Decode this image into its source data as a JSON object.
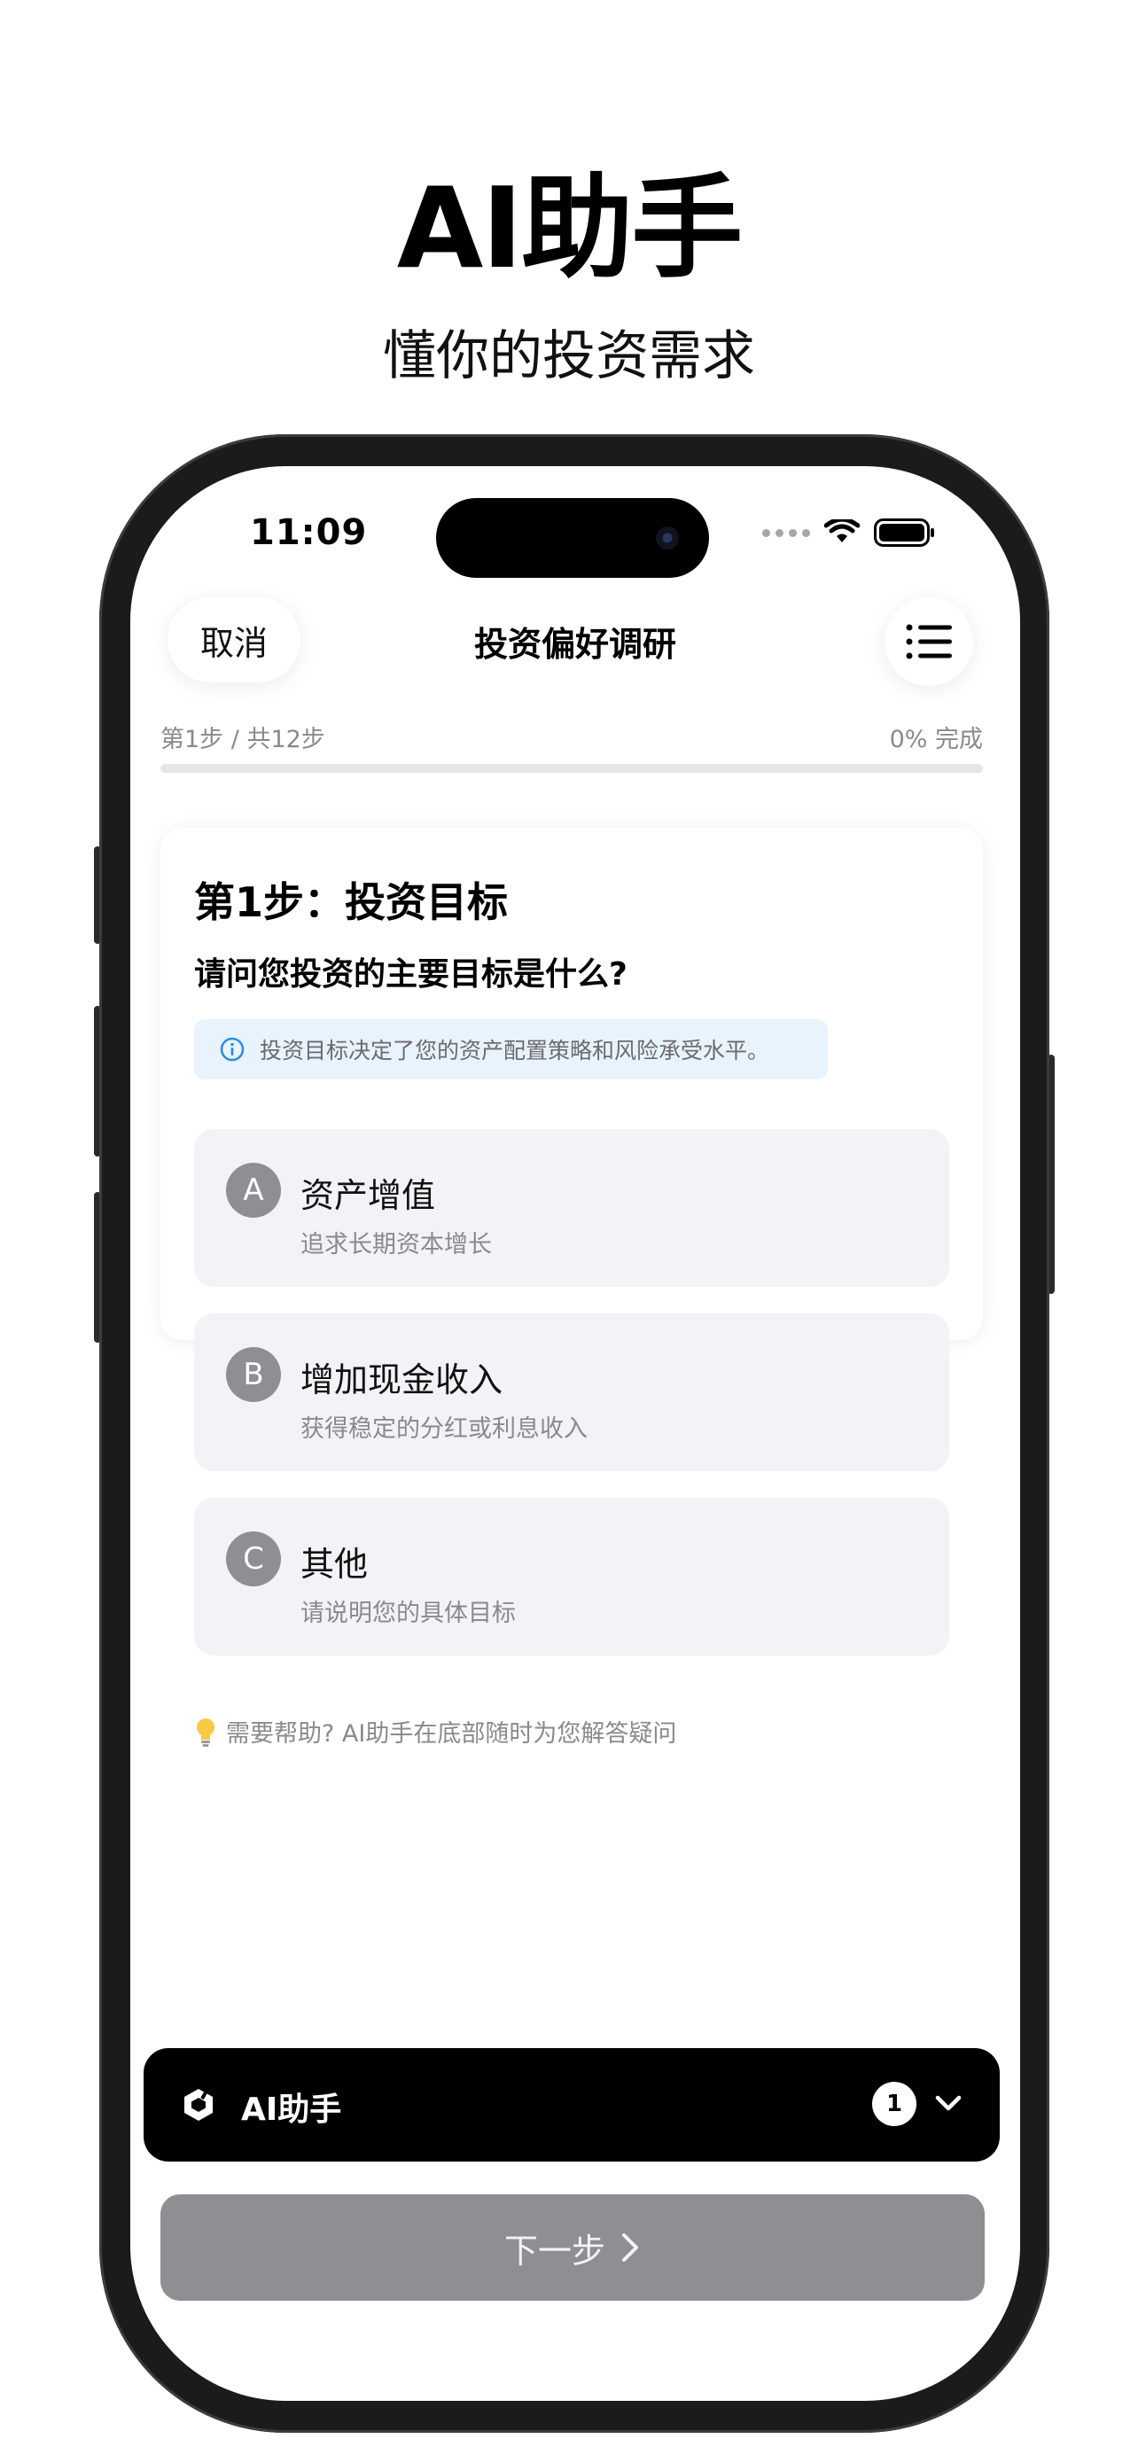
{
  "hero": {
    "title": "AI助手",
    "subtitle": "懂你的投资需求"
  },
  "status_bar": {
    "time": "11:09"
  },
  "nav": {
    "cancel_label": "取消",
    "title": "投资偏好调研",
    "menu_icon": "list-icon"
  },
  "progress": {
    "step_label": "第1步 / 共12步",
    "percent_label": "0% 完成",
    "fraction": 0
  },
  "card": {
    "title": "第1步：投资目标",
    "question": "请问您投资的主要目标是什么?",
    "hint": "投资目标决定了您的资产配置策略和风险承受水平。",
    "options": [
      {
        "key": "A",
        "title": "资产增值",
        "subtitle": "追求长期资本增长"
      },
      {
        "key": "B",
        "title": "增加现金收入",
        "subtitle": "获得稳定的分红或利息收入"
      },
      {
        "key": "C",
        "title": "其他",
        "subtitle": "请说明您的具体目标"
      }
    ],
    "help_text": "需要帮助? AI助手在底部随时为您解答疑问"
  },
  "ai_assistant": {
    "label": "AI助手",
    "badge_count": "1"
  },
  "next_button": {
    "label": "下一步"
  },
  "colors": {
    "accent_dark": "#000000",
    "option_bg": "#f2f2f7",
    "badge_gray": "#8e8e93",
    "hint_bg": "#e8f3fd",
    "hint_icon": "#2f8ee0",
    "disabled_button": "#8e8e93"
  }
}
